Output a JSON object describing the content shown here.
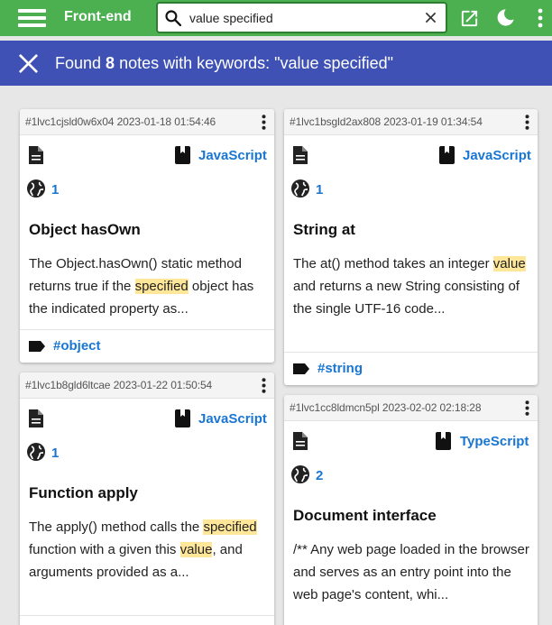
{
  "header": {
    "app_title": "Front-end",
    "search_value": "value specified",
    "bg_color": "#4caf50"
  },
  "results": {
    "prefix": "Found ",
    "count": "8",
    "suffix": " notes with keywords: \"value specified\"",
    "bg_color": "#3f51b5"
  },
  "notes": [
    {
      "meta": "#1lvc1cjsld0w6x04 2023-01-18 01:54:46",
      "language": "JavaScript",
      "link_count": "1",
      "title": "Object hasOwn",
      "desc_parts": [
        "The Object.hasOwn() static method returns true if the ",
        "specified",
        " object has the indicated property as..."
      ],
      "tag": "#object"
    },
    {
      "meta": "#1lvc1bsgld2ax808 2023-01-19 01:34:54",
      "language": "JavaScript",
      "link_count": "1",
      "title": "String at",
      "desc_parts": [
        "The at() method takes an integer ",
        "value",
        " and returns a new String consisting of the single UTF-16 code..."
      ],
      "tag": "#string"
    },
    {
      "meta": "#1lvc1b8gld6ltcae 2023-01-22 01:50:54",
      "language": "JavaScript",
      "link_count": "1",
      "title": "Function apply",
      "desc_parts": [
        "The apply() method calls the ",
        "specified",
        " function with a given this ",
        "value",
        ", and arguments provided as a..."
      ]
    },
    {
      "meta": "#1lvc1cc8ldmcn5pl 2023-02-02 02:18:28",
      "language": "TypeScript",
      "link_count": "2",
      "title": "Document interface",
      "desc_parts": [
        "/** Any web page loaded in the browser and serves as an entry point into the web page's content, whi..."
      ]
    }
  ],
  "icons": {
    "menu": "menu-icon",
    "search": "search-icon",
    "clear": "close-icon",
    "open": "open-in-new-icon",
    "theme": "moon-icon",
    "more": "more-vert-icon",
    "note": "document-icon",
    "language": "book-icon",
    "links": "globe-icon",
    "tag": "tag-icon"
  },
  "colors": {
    "link": "#1976d2",
    "highlight": "#ffe79a",
    "background": "#e7e7e7"
  }
}
